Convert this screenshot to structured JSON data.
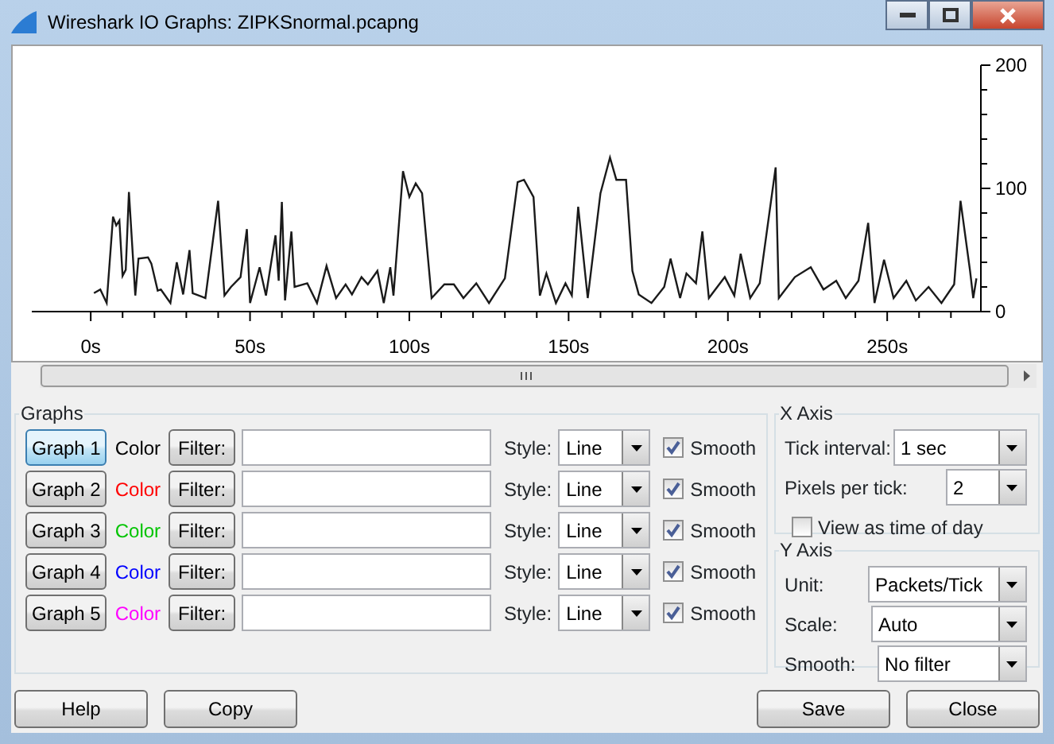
{
  "window": {
    "title": "Wireshark IO Graphs: ZIPKSnormal.pcapng"
  },
  "chart": {
    "chart_data": {
      "type": "line",
      "x": [
        1,
        3,
        5,
        7,
        8,
        9,
        10,
        11,
        12,
        14,
        15,
        18,
        19,
        21,
        22,
        25,
        27,
        29,
        31,
        32,
        36,
        40,
        42,
        44,
        47,
        49,
        50,
        53,
        55,
        58,
        59,
        60,
        61,
        63,
        64,
        68,
        71,
        74,
        77,
        80,
        82,
        85,
        87,
        90,
        92,
        94,
        95,
        98,
        100,
        102,
        104,
        107,
        111,
        114,
        117,
        121,
        125,
        130,
        134,
        136,
        139,
        141,
        143,
        146,
        149,
        151,
        153,
        156,
        157,
        160,
        163,
        165,
        168,
        170,
        172,
        176,
        180,
        182,
        185,
        187,
        190,
        192,
        194,
        199,
        202,
        204,
        207,
        210,
        215,
        216,
        221,
        226,
        230,
        234,
        237,
        241,
        244,
        246,
        249,
        252,
        256,
        259,
        263,
        267,
        271,
        273,
        276,
        277,
        278
      ],
      "series": [
        {
          "color": "#1a1a1a",
          "values": [
            15,
            18,
            7,
            77,
            70,
            74,
            29,
            34,
            97,
            13,
            43,
            44,
            39,
            17,
            18,
            7,
            40,
            14,
            50,
            15,
            11,
            90,
            13,
            20,
            28,
            67,
            7,
            36,
            13,
            62,
            25,
            89,
            9,
            65,
            20,
            23,
            7,
            37,
            11,
            22,
            14,
            28,
            22,
            33,
            7,
            36,
            13,
            114,
            93,
            104,
            96,
            11,
            22,
            22,
            11,
            23,
            7,
            27,
            105,
            107,
            93,
            13,
            31,
            7,
            23,
            13,
            85,
            11,
            32,
            96,
            125,
            107,
            107,
            33,
            14,
            7,
            20,
            43,
            11,
            31,
            23,
            65,
            11,
            28,
            13,
            47,
            11,
            23,
            117,
            11,
            28,
            36,
            18,
            25,
            11,
            25,
            72,
            7,
            42,
            11,
            25,
            9,
            20,
            7,
            22,
            90,
            33,
            11,
            27
          ]
        }
      ],
      "xlim": [
        -18.5,
        279.4
      ],
      "ylim": [
        0,
        200
      ],
      "xticks": [
        {
          "value": 0,
          "label": "0s"
        },
        {
          "value": 50,
          "label": "50s"
        },
        {
          "value": 100,
          "label": "100s"
        },
        {
          "value": 150,
          "label": "150s"
        },
        {
          "value": 200,
          "label": "200s"
        },
        {
          "value": 250,
          "label": "250s"
        }
      ],
      "yticks": [
        0,
        100,
        200
      ]
    }
  },
  "graphs": {
    "title": "Graphs",
    "rows": [
      {
        "button": "Graph 1",
        "selected": true,
        "color_label": "Color",
        "color": "#000000",
        "filter_button": "Filter:",
        "style_label": "Style:",
        "style": "Line",
        "smooth_label": "Smooth",
        "smooth": true
      },
      {
        "button": "Graph 2",
        "selected": false,
        "color_label": "Color",
        "color": "#ff0000",
        "filter_button": "Filter:",
        "style_label": "Style:",
        "style": "Line",
        "smooth_label": "Smooth",
        "smooth": true
      },
      {
        "button": "Graph 3",
        "selected": false,
        "color_label": "Color",
        "color": "#00c400",
        "filter_button": "Filter:",
        "style_label": "Style:",
        "style": "Line",
        "smooth_label": "Smooth",
        "smooth": true
      },
      {
        "button": "Graph 4",
        "selected": false,
        "color_label": "Color",
        "color": "#0000ff",
        "filter_button": "Filter:",
        "style_label": "Style:",
        "style": "Line",
        "smooth_label": "Smooth",
        "smooth": true
      },
      {
        "button": "Graph 5",
        "selected": false,
        "color_label": "Color",
        "color": "#ff00ff",
        "filter_button": "Filter:",
        "style_label": "Style:",
        "style": "Line",
        "smooth_label": "Smooth",
        "smooth": true
      }
    ]
  },
  "x_axis": {
    "title": "X Axis",
    "tick_interval_label": "Tick interval:",
    "tick_interval": "1 sec",
    "pixels_per_tick_label": "Pixels per tick:",
    "pixels_per_tick": "2",
    "view_time_of_day": {
      "label": "View as time of day",
      "checked": false
    }
  },
  "y_axis": {
    "title": "Y Axis",
    "unit_label": "Unit:",
    "unit": "Packets/Tick",
    "scale_label": "Scale:",
    "scale": "Auto",
    "smooth_label": "Smooth:",
    "smooth": "No filter"
  },
  "buttons": {
    "left": [
      "Help",
      "Copy"
    ],
    "right": [
      "Save",
      "Close"
    ]
  }
}
